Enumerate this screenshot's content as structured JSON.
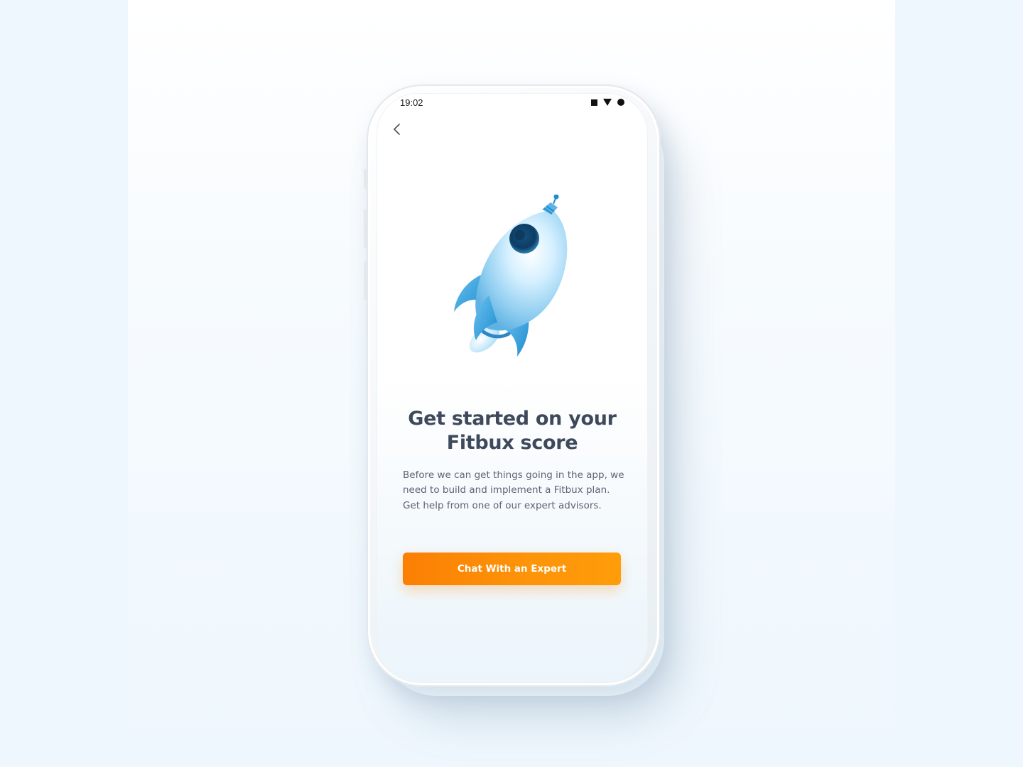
{
  "status_bar": {
    "time": "19:02",
    "icons": [
      "stop-square-icon",
      "wifi-triangle-icon",
      "battery-dot-icon"
    ]
  },
  "nav": {
    "back_icon": "chevron-left-icon"
  },
  "illustration": {
    "icon": "rocket-icon"
  },
  "content": {
    "title_line1": "Get started on your",
    "title_line2": "Fitbux score",
    "body": "Before we can get things going in the app, we need to build and implement a Fitbux plan. Get help from one of our expert advisors."
  },
  "cta": {
    "label": "Chat With an Expert"
  },
  "colors": {
    "accent_start": "#fb7f03",
    "accent_end": "#fe9d0a",
    "title": "#3e4a5c",
    "body": "#5c6575",
    "rocket": "#8fcdf0"
  }
}
